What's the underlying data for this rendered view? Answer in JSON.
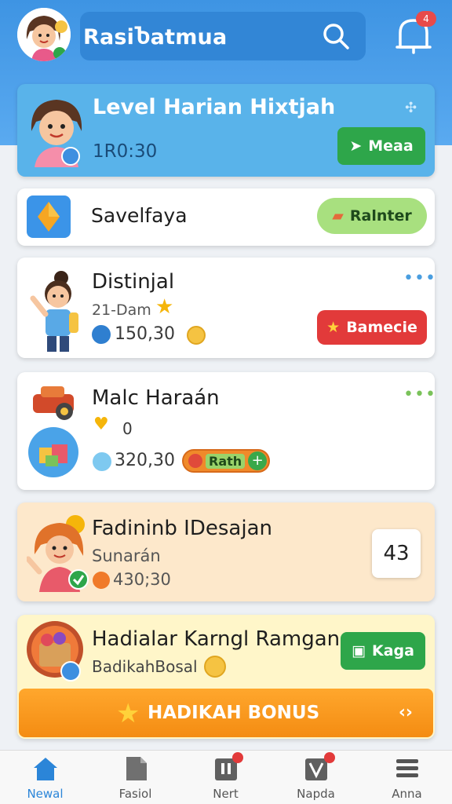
{
  "header": {
    "title": "RasiႦatmua",
    "notification_count": "4"
  },
  "level_card": {
    "title": "Level Harian Hixtjah",
    "time": "1R0:30",
    "button_label": "Meaа"
  },
  "save_card": {
    "title": "Savelfaya",
    "button_label": "Ralnter"
  },
  "distinjal_card": {
    "title": "Distinjal",
    "meta": "21-Dam",
    "value": "150,30",
    "button_label": "Bamecie"
  },
  "malc_card": {
    "title": "Malc Haraán",
    "count": "0",
    "value": "320,30",
    "pill_label": "Rath"
  },
  "fadininb_card": {
    "title": "Fadininb IDesajan",
    "sub": "Sunarán",
    "value": "430;30",
    "count": "43"
  },
  "hadialar_card": {
    "title": "Hadialar Karngl Ramgan",
    "sub": "BadikahBosal",
    "button_label": "Kaga",
    "bonus_label": "HADIKAH BONUS"
  },
  "bottom_nav": [
    {
      "label": "Newal",
      "active": true
    },
    {
      "label": "Fasiol",
      "active": false
    },
    {
      "label": "Nert",
      "active": false
    },
    {
      "label": "Napda",
      "active": false
    },
    {
      "label": "Anna",
      "active": false
    }
  ],
  "colors": {
    "primary_blue": "#3e94e3",
    "green": "#2ea64a",
    "red": "#e23a3a",
    "orange": "#f48c12"
  }
}
